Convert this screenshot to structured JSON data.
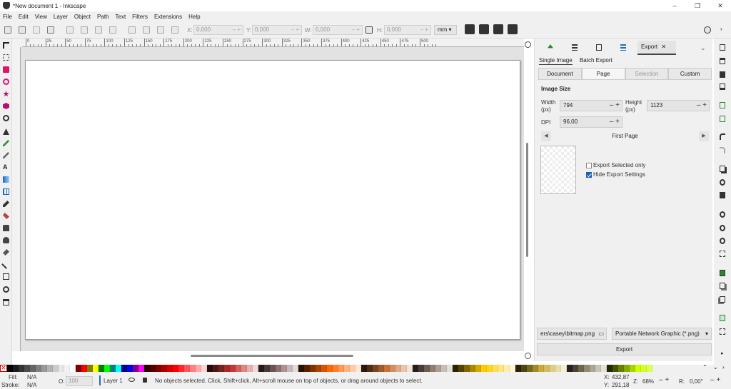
{
  "window": {
    "title": "*New document 1 - Inkscape",
    "minimize": "–",
    "maximize": "❐",
    "close": "✕"
  },
  "menu": [
    "File",
    "Edit",
    "View",
    "Layer",
    "Object",
    "Path",
    "Text",
    "Filters",
    "Extensions",
    "Help"
  ],
  "toolbar": {
    "x_label": "X:",
    "x_value": "0,000",
    "y_label": "Y:",
    "y_value": "0,000",
    "w_label": "W:",
    "w_value": "0,000",
    "h_label": "H:",
    "h_value": "0,000",
    "unit": "mm ▾",
    "pm": "– +"
  },
  "ruler": {
    "labels": [
      "0",
      "25",
      "50",
      "75",
      "100",
      "125",
      "150",
      "175",
      "200",
      "225",
      "250",
      "275",
      "300",
      "325",
      "350",
      "375",
      "400",
      "425",
      "450",
      "475",
      "500"
    ]
  },
  "panel": {
    "export_tab": "Export",
    "export_close": "✕",
    "single_image": "Single Image",
    "batch_export": "Batch Export",
    "modes": [
      "Document",
      "Page",
      "Selection",
      "Custom"
    ],
    "image_size": "Image Size",
    "width_label": "Width (px)",
    "width_value": "794",
    "height_label": "Height (px)",
    "height_value": "1123",
    "dpi_label": "DPI",
    "dpi_value": "96,00",
    "page_name": "First Page",
    "export_selected_only": "Export Selected only",
    "hide_export_settings": "Hide Export Settings",
    "filename": "ers\\casey\\bitmap.png",
    "format": "Portable Network Graphic (*.png)",
    "export_button": "Export",
    "pm": "– +"
  },
  "status": {
    "fill_label": "Fill:",
    "fill_value": "N/A",
    "stroke_label": "Stroke:",
    "stroke_value": "N/A",
    "opacity_label": "O:",
    "opacity_value": "100",
    "layer": "Layer 1",
    "message": "No objects selected. Click, Shift+click, Alt+scroll mouse on top of objects, or drag around objects to select.",
    "x_label": "X:",
    "x_value": "432,87",
    "y_label": "Y:",
    "y_value": "291,18",
    "zoom_label": "Z:",
    "zoom_value": "68%",
    "rot_label": "R:",
    "rot_value": "0,00°"
  },
  "colors": {
    "palette": [
      "#000000",
      "#1a1a1a",
      "#333333",
      "#4d4d4d",
      "#666666",
      "#808080",
      "#999999",
      "#b3b3b3",
      "#cccccc",
      "#e6e6e6",
      "#f2f2f2",
      "#ffffff",
      "#800000",
      "#ff0000",
      "#808000",
      "#ffff00",
      "#008000",
      "#00ff00",
      "#008080",
      "#00ffff",
      "#000080",
      "#0000ff",
      "#800080",
      "#ff00ff",
      "#2b0000",
      "#550000",
      "#800000",
      "#aa0000",
      "#d40000",
      "#ff0000",
      "#ff2a2a",
      "#ff5555",
      "#ff8080",
      "#ffaaaa",
      "#ffd5d5",
      "#280b0b",
      "#501616",
      "#782121",
      "#a02c2c",
      "#c83737",
      "#d35f5f",
      "#de8787",
      "#e9afaf",
      "#f4d7d7",
      "#241c1c",
      "#483737",
      "#6c5353",
      "#916f6f",
      "#ac9393",
      "#c8b7b7",
      "#e3dbdb",
      "#2b1100",
      "#552200",
      "#803300",
      "#aa4400",
      "#d45500",
      "#ff6600",
      "#ff7f2a",
      "#ff9955",
      "#ffb380",
      "#ffccaa",
      "#ffe6d5",
      "#28170b",
      "#502d16",
      "#784421",
      "#a05a2c",
      "#c87137",
      "#d38d5f",
      "#deaa87",
      "#e9c6af",
      "#f4e3d7",
      "#241f1c",
      "#483e37",
      "#6c5d53",
      "#917c6f",
      "#ac9d93",
      "#c8beb7",
      "#e3dedb",
      "#2b2200",
      "#554400",
      "#806600",
      "#aa8800",
      "#d4aa00",
      "#ffcc00",
      "#ffd42a",
      "#ffdd55",
      "#ffe680",
      "#ffeeaa",
      "#fff6d5",
      "#28220b",
      "#504416",
      "#786721",
      "#a0892c",
      "#c8ab37",
      "#d3bc5f",
      "#decd87",
      "#e9ddaf",
      "#f4eed7",
      "#24221c",
      "#484537",
      "#6c6753",
      "#918a6f",
      "#aca793",
      "#c8c4b7",
      "#e3e2db",
      "#222b00",
      "#445500",
      "#668000",
      "#88aa00",
      "#aad400",
      "#ccff00",
      "#d4ff2a",
      "#ddff55"
    ]
  }
}
